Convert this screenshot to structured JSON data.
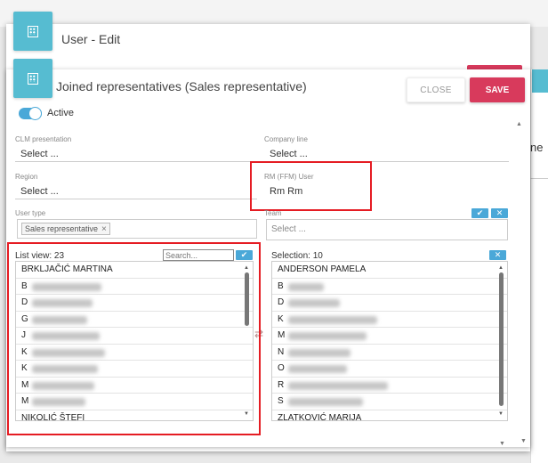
{
  "outer": {
    "title": "User - Edit"
  },
  "background": {
    "partial_text": "ne ⇕"
  },
  "dialog": {
    "title": "Joined representatives (Sales representative)",
    "close_label": "CLOSE",
    "save_label": "SAVE",
    "active_label": "Active",
    "active": true
  },
  "form": {
    "clm": {
      "label": "CLM presentation",
      "value": "Select ..."
    },
    "company_line": {
      "label": "Company line",
      "value": "Select ..."
    },
    "region": {
      "label": "Region",
      "value": "Select ..."
    },
    "rm_user": {
      "label": "RM (FFM) User",
      "value": "Rm Rm"
    },
    "user_type": {
      "label": "User type",
      "tag": "Sales representative",
      "tag_remove": "×"
    },
    "team": {
      "label": "Team",
      "placeholder": "Select ..."
    }
  },
  "list_view": {
    "label": "List view: 23",
    "search_placeholder": "Search...",
    "scrollbar_position": 0.0,
    "items": [
      "BRKLJAČIĆ MARTINA",
      "B",
      "D",
      "G",
      "J",
      "K",
      "K",
      "M",
      "M",
      "NIKOLIĆ ŠTEFI"
    ]
  },
  "selection": {
    "label": "Selection: 10",
    "scrollbar_position": 0.0,
    "items": [
      "ANDERSON PAMELA",
      "B",
      "D",
      "K",
      "M",
      "N",
      "O",
      "R",
      "S",
      "ZLATKOVIĆ MARIJA"
    ]
  },
  "icons": {
    "check": "✔",
    "close": "✕",
    "swap": "⇄"
  },
  "colors": {
    "accent_teal": "#56bcd1",
    "save_red": "#d83a5c",
    "toggle_blue": "#4aa8d8",
    "highlight_red": "#e51c23"
  }
}
